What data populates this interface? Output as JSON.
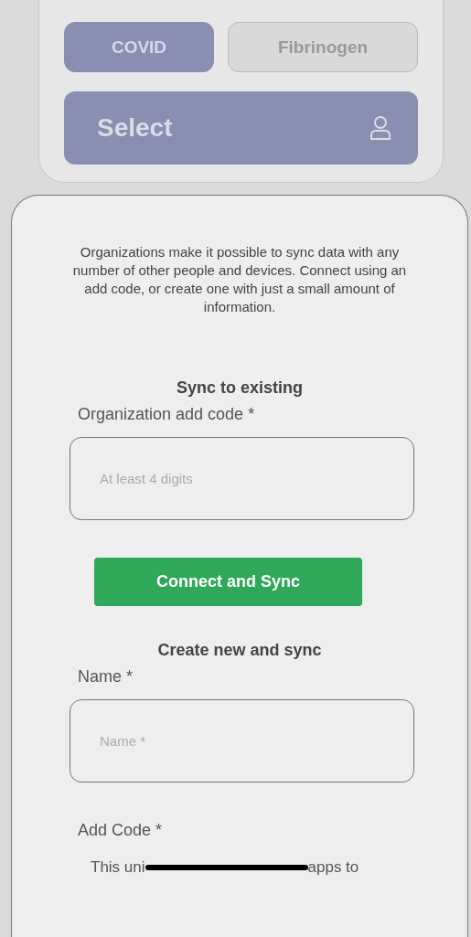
{
  "tabs": [
    {
      "label": "COVID",
      "selected": true
    },
    {
      "label": "Fibrinogen",
      "selected": false
    }
  ],
  "select": {
    "label": "Select"
  },
  "sheet": {
    "intro": "Organizations make it possible to sync data with any number of other people and devices. Connect using an add code, or create one with just a small amount of information.",
    "sync_existing": {
      "heading": "Sync to existing",
      "field_label": "Organization add code *",
      "placeholder": "At least 4 digits",
      "button": "Connect and Sync"
    },
    "create_new": {
      "heading": "Create new and sync",
      "name_label": "Name *",
      "name_placeholder": "Name *",
      "add_code_label": "Add Code *",
      "hint_start": "This uni",
      "hint_end": "apps to"
    }
  }
}
